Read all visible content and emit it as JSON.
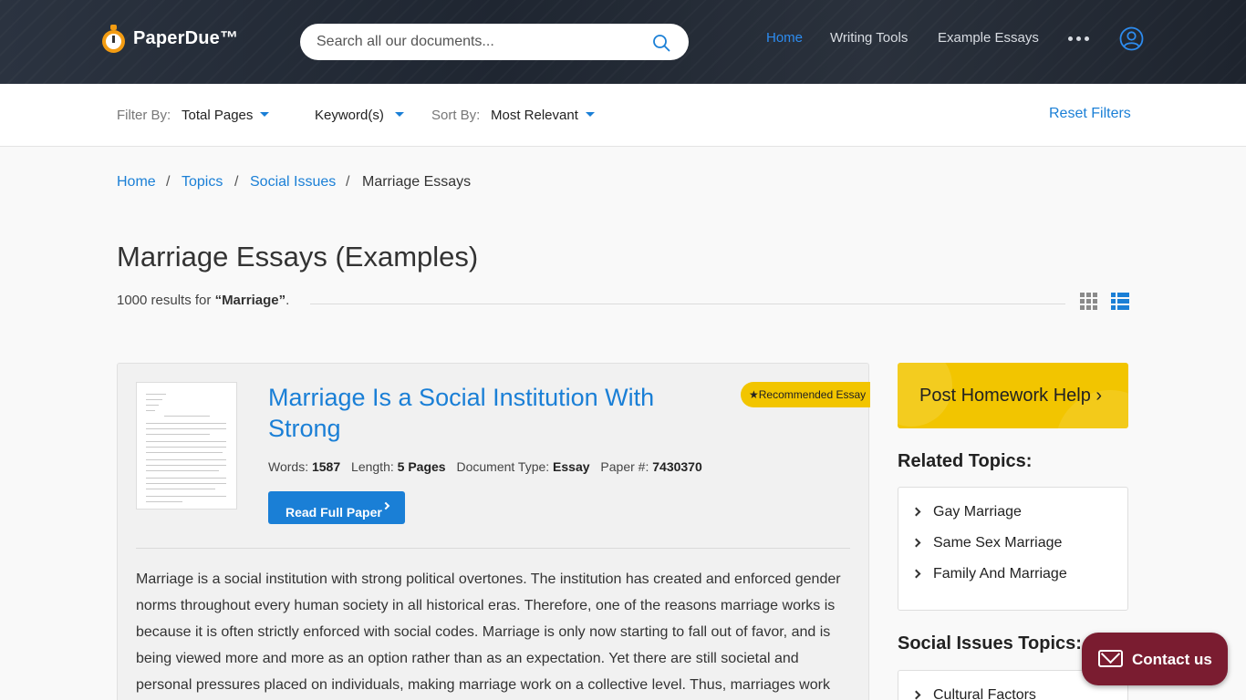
{
  "header": {
    "brand": "PaperDue™",
    "search_placeholder": "Search all our documents...",
    "nav": [
      "Home",
      "Writing Tools",
      "Example Essays"
    ]
  },
  "filters": {
    "filter_by_label": "Filter By:",
    "total_pages": "Total Pages",
    "keywords": "Keyword(s)",
    "sort_by_label": "Sort By:",
    "sort_value": "Most Relevant",
    "reset": "Reset Filters"
  },
  "breadcrumb": {
    "home": "Home",
    "topics": "Topics",
    "social_issues": "Social Issues",
    "current": "Marriage Essays",
    "separator": "/"
  },
  "page": {
    "title": "Marriage Essays (Examples)",
    "results_count": "1000 results for",
    "query": "“Marriage”",
    "results_suffix": "."
  },
  "essay": {
    "title": "Marriage Is a Social Institution With Strong",
    "badge": "★Recommended Essay",
    "words_label": "Words:",
    "words": "1587",
    "length_label": "Length:",
    "length": "5 Pages",
    "doctype_label": "Document Type:",
    "doctype": "Essay",
    "paper_label": "Paper #:",
    "paper_no": "7430370",
    "read_button": "Read Full Paper",
    "excerpt": "Marriage is a social institution with strong political overtones. The institution has created and enforced gender norms throughout every human society in all historical eras. Therefore, one of the reasons marriage works is because it is often strictly enforced with social codes. Marriage is only now starting to fall out of favor, and is being viewed more and more as an option rather than as an expectation. Yet there are still societal and personal pressures placed on individuals, making marriage work on a collective level. Thus, marriages work"
  },
  "sidebar": {
    "homework_button": "Post Homework Help ›",
    "related_heading": "Related Topics:",
    "related": [
      "Gay Marriage",
      "Same Sex Marriage",
      "Family And Marriage"
    ],
    "social_heading": "Social Issues Topics:",
    "social": [
      "Cultural Factors"
    ]
  },
  "contact": {
    "label": "Contact us"
  },
  "colors": {
    "accent": "#1a7fd6",
    "badge": "#f2c500",
    "contact": "#7a1c30"
  }
}
